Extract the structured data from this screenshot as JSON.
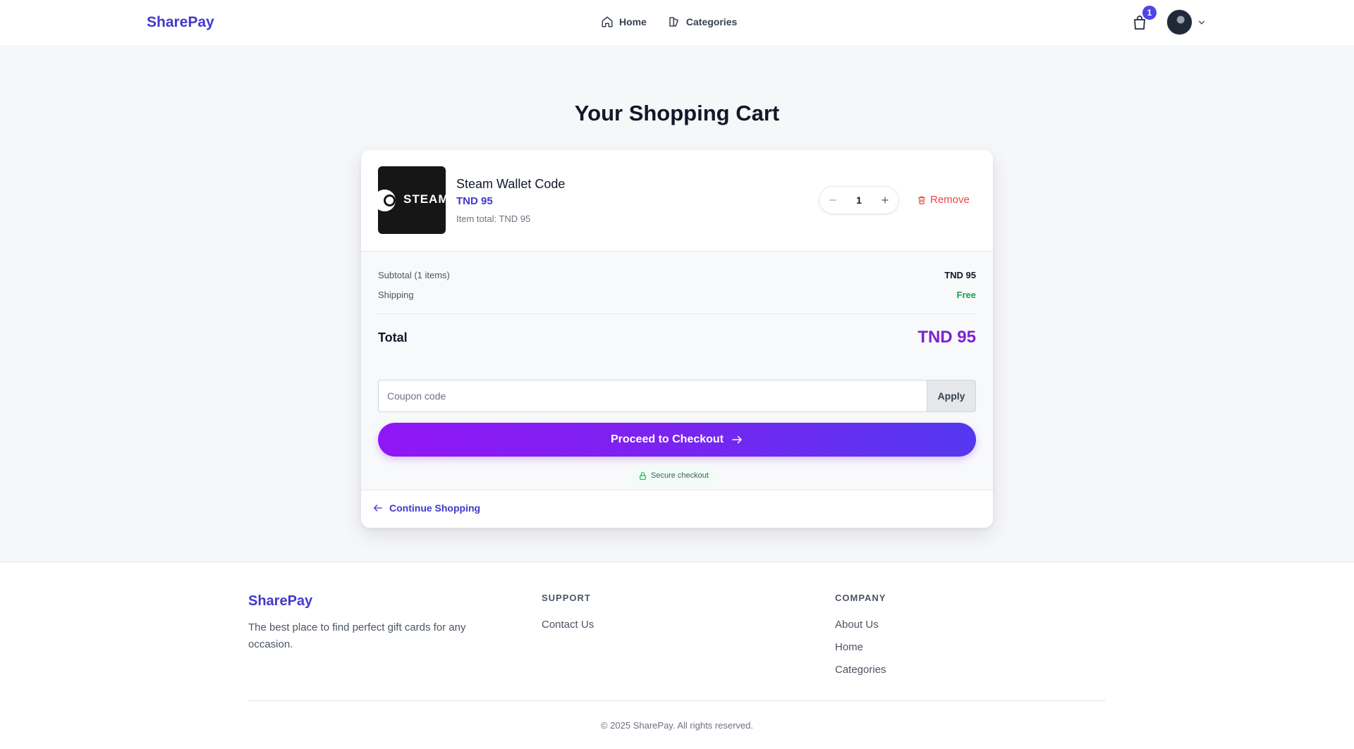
{
  "header": {
    "brand": "SharePay",
    "nav": [
      {
        "label": "Home",
        "icon": "home-icon"
      },
      {
        "label": "Categories",
        "icon": "categories-icon"
      }
    ],
    "cart_count": "1"
  },
  "page": {
    "title": "Your Shopping Cart"
  },
  "cart": {
    "items": [
      {
        "name": "Steam Wallet Code",
        "thumb_text": "STEAM",
        "price": "TND 95",
        "item_total": "Item total: TND 95",
        "quantity": "1",
        "remove_label": "Remove"
      }
    ]
  },
  "summary": {
    "subtotal_label": "Subtotal (1 items)",
    "subtotal_value": "TND 95",
    "shipping_label": "Shipping",
    "shipping_value": "Free",
    "total_label": "Total",
    "total_value": "TND 95",
    "coupon_placeholder": "Coupon code",
    "coupon_value": "",
    "apply_label": "Apply",
    "checkout_label": "Proceed to Checkout",
    "secure_label": "Secure checkout"
  },
  "continue_label": "Continue Shopping",
  "footer": {
    "brand": "SharePay",
    "tagline": "The best place to find perfect gift cards for any occasion.",
    "support_title": "SUPPORT",
    "support_links": [
      "Contact Us"
    ],
    "company_title": "COMPANY",
    "company_links": [
      "About Us",
      "Home",
      "Categories"
    ],
    "copyright": "© 2025 SharePay. All rights reserved."
  },
  "colors": {
    "brand": "#4338ca",
    "remove": "#ef4444",
    "free": "#16a34a",
    "total": "#7e22ce",
    "checkout_gradient_start": "#9016f7",
    "checkout_gradient_end": "#5438f0"
  }
}
